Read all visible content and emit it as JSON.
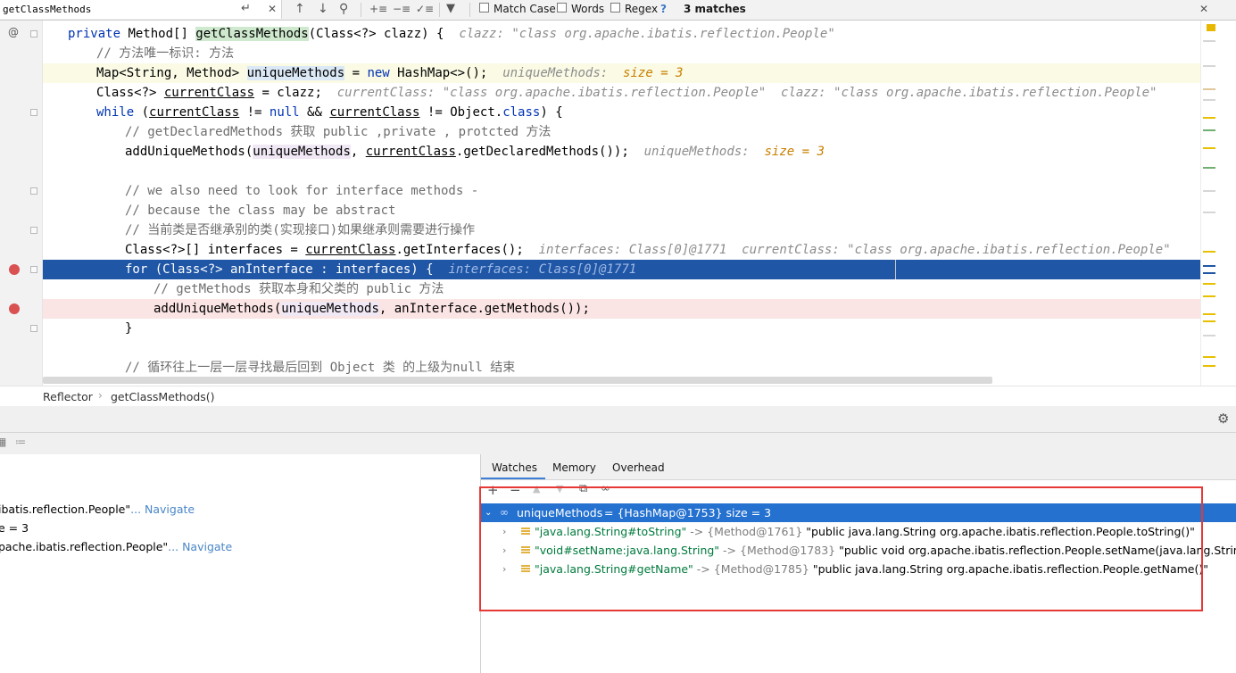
{
  "find_bar": {
    "query": "getClassMethods",
    "match_case_label": "Match Case",
    "words_label": "Words",
    "regex_label": "Regex",
    "help_label": "?",
    "matches_label": "3 matches"
  },
  "editor": {
    "lines": [
      {
        "segments": [
          {
            "t": "private ",
            "c": "kw"
          },
          {
            "t": "Method[] "
          },
          {
            "t": "getClassMethods",
            "c": "hl-green"
          },
          {
            "t": "(Class<?> clazz) {  "
          },
          {
            "t": "clazz: \"class org.apache.ibatis.reflection.People\"",
            "c": "hint"
          }
        ]
      },
      {
        "segments": [
          {
            "t": "// 方法唯一标识: 方法",
            "c": "cm"
          }
        ]
      },
      {
        "segments": [
          {
            "t": "Map<String, Method> "
          },
          {
            "t": "uniqueMethods",
            "c": "hl-blue"
          },
          {
            "t": " = "
          },
          {
            "t": "new",
            "c": "kw"
          },
          {
            "t": " HashMap<>();  "
          },
          {
            "t": "uniqueMethods:  ",
            "c": "hint"
          },
          {
            "t": "size = 3",
            "c": "num"
          }
        ]
      },
      {
        "segments": [
          {
            "t": "Class<?> "
          },
          {
            "t": "currentClass",
            "c": "ul"
          },
          {
            "t": " = clazz;  "
          },
          {
            "t": "currentClass: \"class org.apache.ibatis.reflection.People\"  clazz: \"class org.apache.ibatis.reflection.People\"",
            "c": "hint"
          }
        ]
      },
      {
        "segments": [
          {
            "t": "while",
            "c": "kw"
          },
          {
            "t": " ("
          },
          {
            "t": "currentClass",
            "c": "ul"
          },
          {
            "t": " != "
          },
          {
            "t": "null",
            "c": "kw"
          },
          {
            "t": " && "
          },
          {
            "t": "currentClass",
            "c": "ul"
          },
          {
            "t": " != Object."
          },
          {
            "t": "class",
            "c": "kw"
          },
          {
            "t": ") {"
          }
        ]
      },
      {
        "segments": [
          {
            "t": "// getDeclaredMethods 获取 public ,private , protcted 方法",
            "c": "cm"
          }
        ]
      },
      {
        "segments": [
          {
            "t": "addUniqueMethods("
          },
          {
            "t": "uniqueMethods",
            "c": "hl-purple"
          },
          {
            "t": ", "
          },
          {
            "t": "currentClass",
            "c": "ul"
          },
          {
            "t": ".getDeclaredMethods());  "
          },
          {
            "t": "uniqueMethods:  ",
            "c": "hint"
          },
          {
            "t": "size = 3",
            "c": "num"
          }
        ]
      },
      {
        "segments": []
      },
      {
        "segments": [
          {
            "t": "// we also need to look for interface methods -",
            "c": "cm"
          }
        ]
      },
      {
        "segments": [
          {
            "t": "// because the class may be abstract",
            "c": "cm"
          }
        ]
      },
      {
        "segments": [
          {
            "t": "// 当前类是否继承别的类(实现接口)如果继承则需要进行操作",
            "c": "cm"
          }
        ]
      },
      {
        "segments": [
          {
            "t": "Class<?>[] interfaces = "
          },
          {
            "t": "currentClass",
            "c": "ul"
          },
          {
            "t": ".getInterfaces();  "
          },
          {
            "t": "interfaces: Class[0]@1771  currentClass: \"class org.apache.ibatis.reflection.People\"",
            "c": "hint"
          }
        ]
      },
      {
        "segments": [
          {
            "t": "for",
            "c": "kw"
          },
          {
            "t": " (Class<?> anInterface : interfaces) {  "
          },
          {
            "t": "interfaces: Class[0]@1771",
            "c": "hint"
          }
        ]
      },
      {
        "segments": [
          {
            "t": "// getMethods 获取本身和父类的 public 方法",
            "c": "cm"
          }
        ]
      },
      {
        "segments": [
          {
            "t": "addUniqueMethods("
          },
          {
            "t": "uniqueMethods",
            "c": "hl-purple"
          },
          {
            "t": ", anInterface.getMethods());"
          }
        ]
      },
      {
        "segments": [
          {
            "t": "}"
          }
        ]
      },
      {
        "segments": []
      },
      {
        "segments": [
          {
            "t": "// 循环往上一层一层寻找最后回到 Object 类 的上级为null 结束",
            "c": "cm"
          }
        ]
      }
    ]
  },
  "breadcrumb": {
    "class_name": "Reflector",
    "method_name": "getClassMethods()"
  },
  "left_pane": {
    "rows": [
      {
        "text": "ibatis.reflection.People\"",
        "link": "... Navigate"
      },
      {
        "text": "e = 3",
        "link": ""
      },
      {
        "text": "pache.ibatis.reflection.People\"",
        "link": "... Navigate"
      }
    ]
  },
  "debug_tabs": {
    "watches": "Watches",
    "memory": "Memory",
    "overhead": "Overhead"
  },
  "watches": {
    "root": {
      "name": "uniqueMethods",
      "value": " = {HashMap@1753}  size = 3"
    },
    "entries": [
      {
        "key": "\"java.lang.String#toString\"",
        "arrow": " -> ",
        "ref": "{Method@1761}",
        "value": " \"public java.lang.String org.apache.ibatis.reflection.People.toString()\""
      },
      {
        "key": "\"void#setName:java.lang.String\"",
        "arrow": " -> ",
        "ref": "{Method@1783}",
        "value": " \"public void org.apache.ibatis.reflection.People.setName(java.lang.String)\""
      },
      {
        "key": "\"java.lang.String#getName\"",
        "arrow": " -> ",
        "ref": "{Method@1785}",
        "value": " \"public java.lang.String org.apache.ibatis.reflection.People.getName()\""
      }
    ]
  }
}
